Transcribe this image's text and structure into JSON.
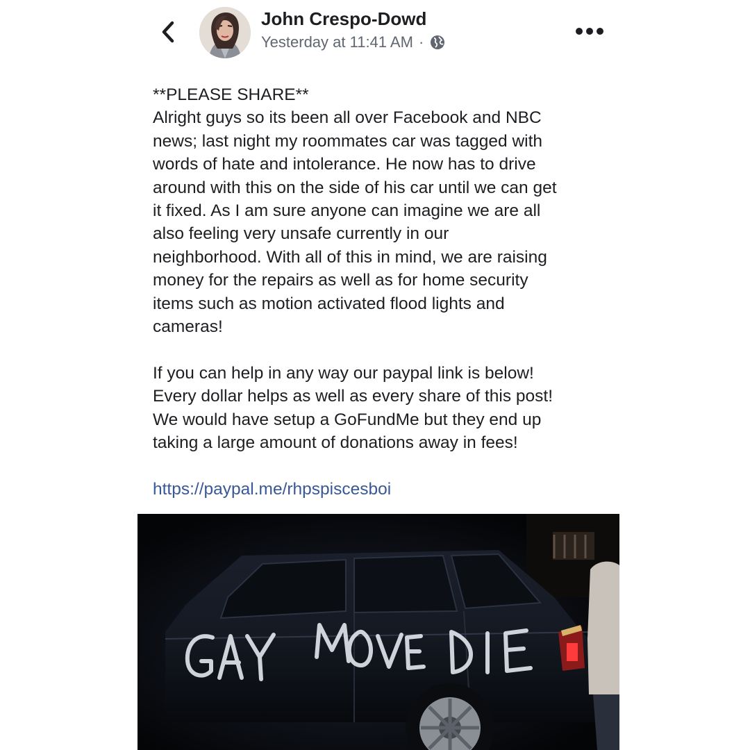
{
  "post": {
    "author": "John Crespo-Dowd",
    "timestamp": "Yesterday at 11:41 AM",
    "separator": "·",
    "privacy_icon": "globe-icon",
    "body_lines": [
      "**PLEASE SHARE**",
      "Alright guys so its been all over Facebook and NBC",
      "news; last night my roommates car was tagged with",
      "words of hate and intolerance. He now has to drive",
      "around with this on the side of his car until we can get",
      "it fixed. As I am sure anyone can imagine we are all",
      "also feeling very unsafe currently in our",
      "neighborhood. With all of this in mind, we are raising",
      "money for the repairs as well as for home security",
      "items such as motion activated flood lights and",
      "cameras!",
      "",
      "If you can help in any way our paypal link is below!",
      "Every dollar helps as well as every share of this post!",
      "We would have setup a GoFundMe but they end up",
      "taking a large amount of donations away in fees!"
    ],
    "link": "https://paypal.me/rhpspiscesboi",
    "photo": {
      "graffiti_text": "GAY MOVE DIE"
    }
  },
  "icons": {
    "back": "chevron-left-icon",
    "more": "more-horizontal-icon"
  },
  "colors": {
    "text": "#1c1e21",
    "meta": "#606770",
    "link": "#385898",
    "photo_background": "#07080a"
  }
}
